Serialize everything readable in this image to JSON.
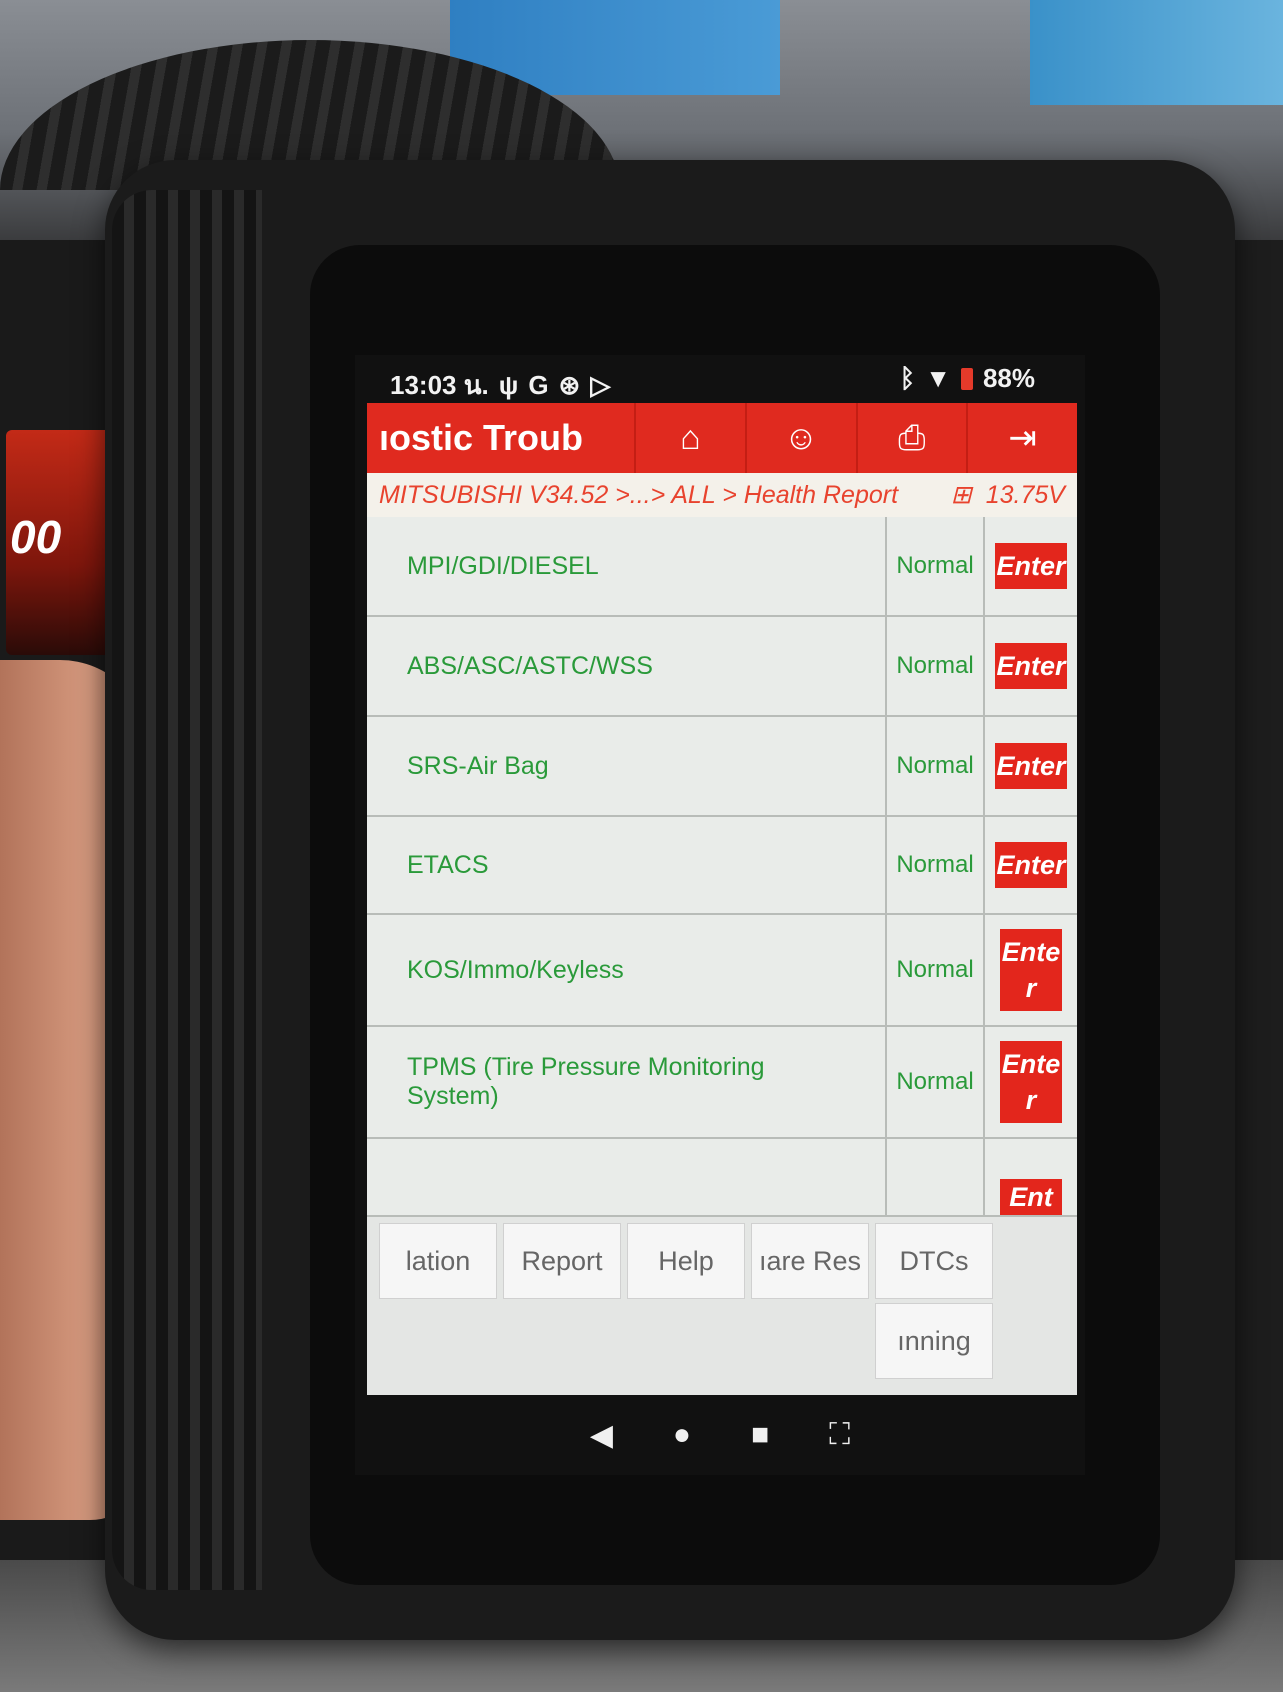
{
  "status_bar": {
    "time": "13:03 น.",
    "left_icons": [
      "usb-icon",
      "google-icon",
      "settings-circle-icon",
      "play-icon"
    ],
    "battery": "88%"
  },
  "app_header": {
    "title": "ıostic Troub",
    "buttons": [
      {
        "name": "home-icon",
        "glyph": "⌂"
      },
      {
        "name": "support-agent-icon",
        "glyph": "☺"
      },
      {
        "name": "print-icon",
        "glyph": "⎙"
      },
      {
        "name": "exit-icon",
        "glyph": "⇥"
      }
    ]
  },
  "breadcrumb": {
    "path": "MITSUBISHI V34.52 >...> ALL > Health Report",
    "voltage": "13.75V"
  },
  "systems": [
    {
      "name": "MPI/GDI/DIESEL",
      "status": "Normal",
      "action": "Enter"
    },
    {
      "name": "ABS/ASC/ASTC/WSS",
      "status": "Normal",
      "action": "Enter"
    },
    {
      "name": "SRS-Air Bag",
      "status": "Normal",
      "action": "Enter"
    },
    {
      "name": "ETACS",
      "status": "Normal",
      "action": "Enter"
    },
    {
      "name": "KOS/Immo/Keyless",
      "status": "Normal",
      "action": "Enter"
    },
    {
      "name": "TPMS (Tire Pressure Monitoring System)",
      "status": "Normal",
      "action": "Enter"
    },
    {
      "name": "",
      "status": "",
      "action": "Ent"
    }
  ],
  "bottom_buttons": [
    "lation",
    "Report",
    "Help",
    "ıare Res",
    "DTCs",
    "ınning"
  ],
  "nav_bar": {
    "back": "◀",
    "home": "●",
    "recents": "■",
    "screenshot": "⛶"
  },
  "dash_readout": "00",
  "colors": {
    "header_red": "#e02a1f",
    "text_green": "#2a9a3a",
    "breadcrumb_orange": "#e8432e"
  }
}
